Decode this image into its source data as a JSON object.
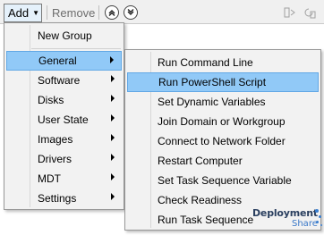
{
  "toolbar": {
    "add_label": "Add",
    "remove_label": "Remove"
  },
  "menu": {
    "items": [
      {
        "label": "New Group",
        "has_submenu": false
      },
      {
        "label": "General",
        "has_submenu": true,
        "highlighted": true
      },
      {
        "label": "Software",
        "has_submenu": true
      },
      {
        "label": "Disks",
        "has_submenu": true
      },
      {
        "label": "User State",
        "has_submenu": true
      },
      {
        "label": "Images",
        "has_submenu": true
      },
      {
        "label": "Drivers",
        "has_submenu": true
      },
      {
        "label": "MDT",
        "has_submenu": true
      },
      {
        "label": "Settings",
        "has_submenu": true
      }
    ]
  },
  "submenu": {
    "items": [
      {
        "label": "Run Command Line"
      },
      {
        "label": "Run PowerShell Script",
        "highlighted": true
      },
      {
        "label": "Set Dynamic Variables"
      },
      {
        "label": "Join Domain or Workgroup"
      },
      {
        "label": "Connect to Network Folder"
      },
      {
        "label": "Restart Computer"
      },
      {
        "label": "Set Task Sequence Variable"
      },
      {
        "label": "Check Readiness"
      },
      {
        "label": "Run Task Sequence"
      }
    ]
  },
  "logo": {
    "line1": "Deployment",
    "line2": "Share"
  },
  "colors": {
    "highlight": "#91c9f7",
    "highlight_border": "#62a8e5",
    "menu_bg": "#f2f2f2"
  }
}
